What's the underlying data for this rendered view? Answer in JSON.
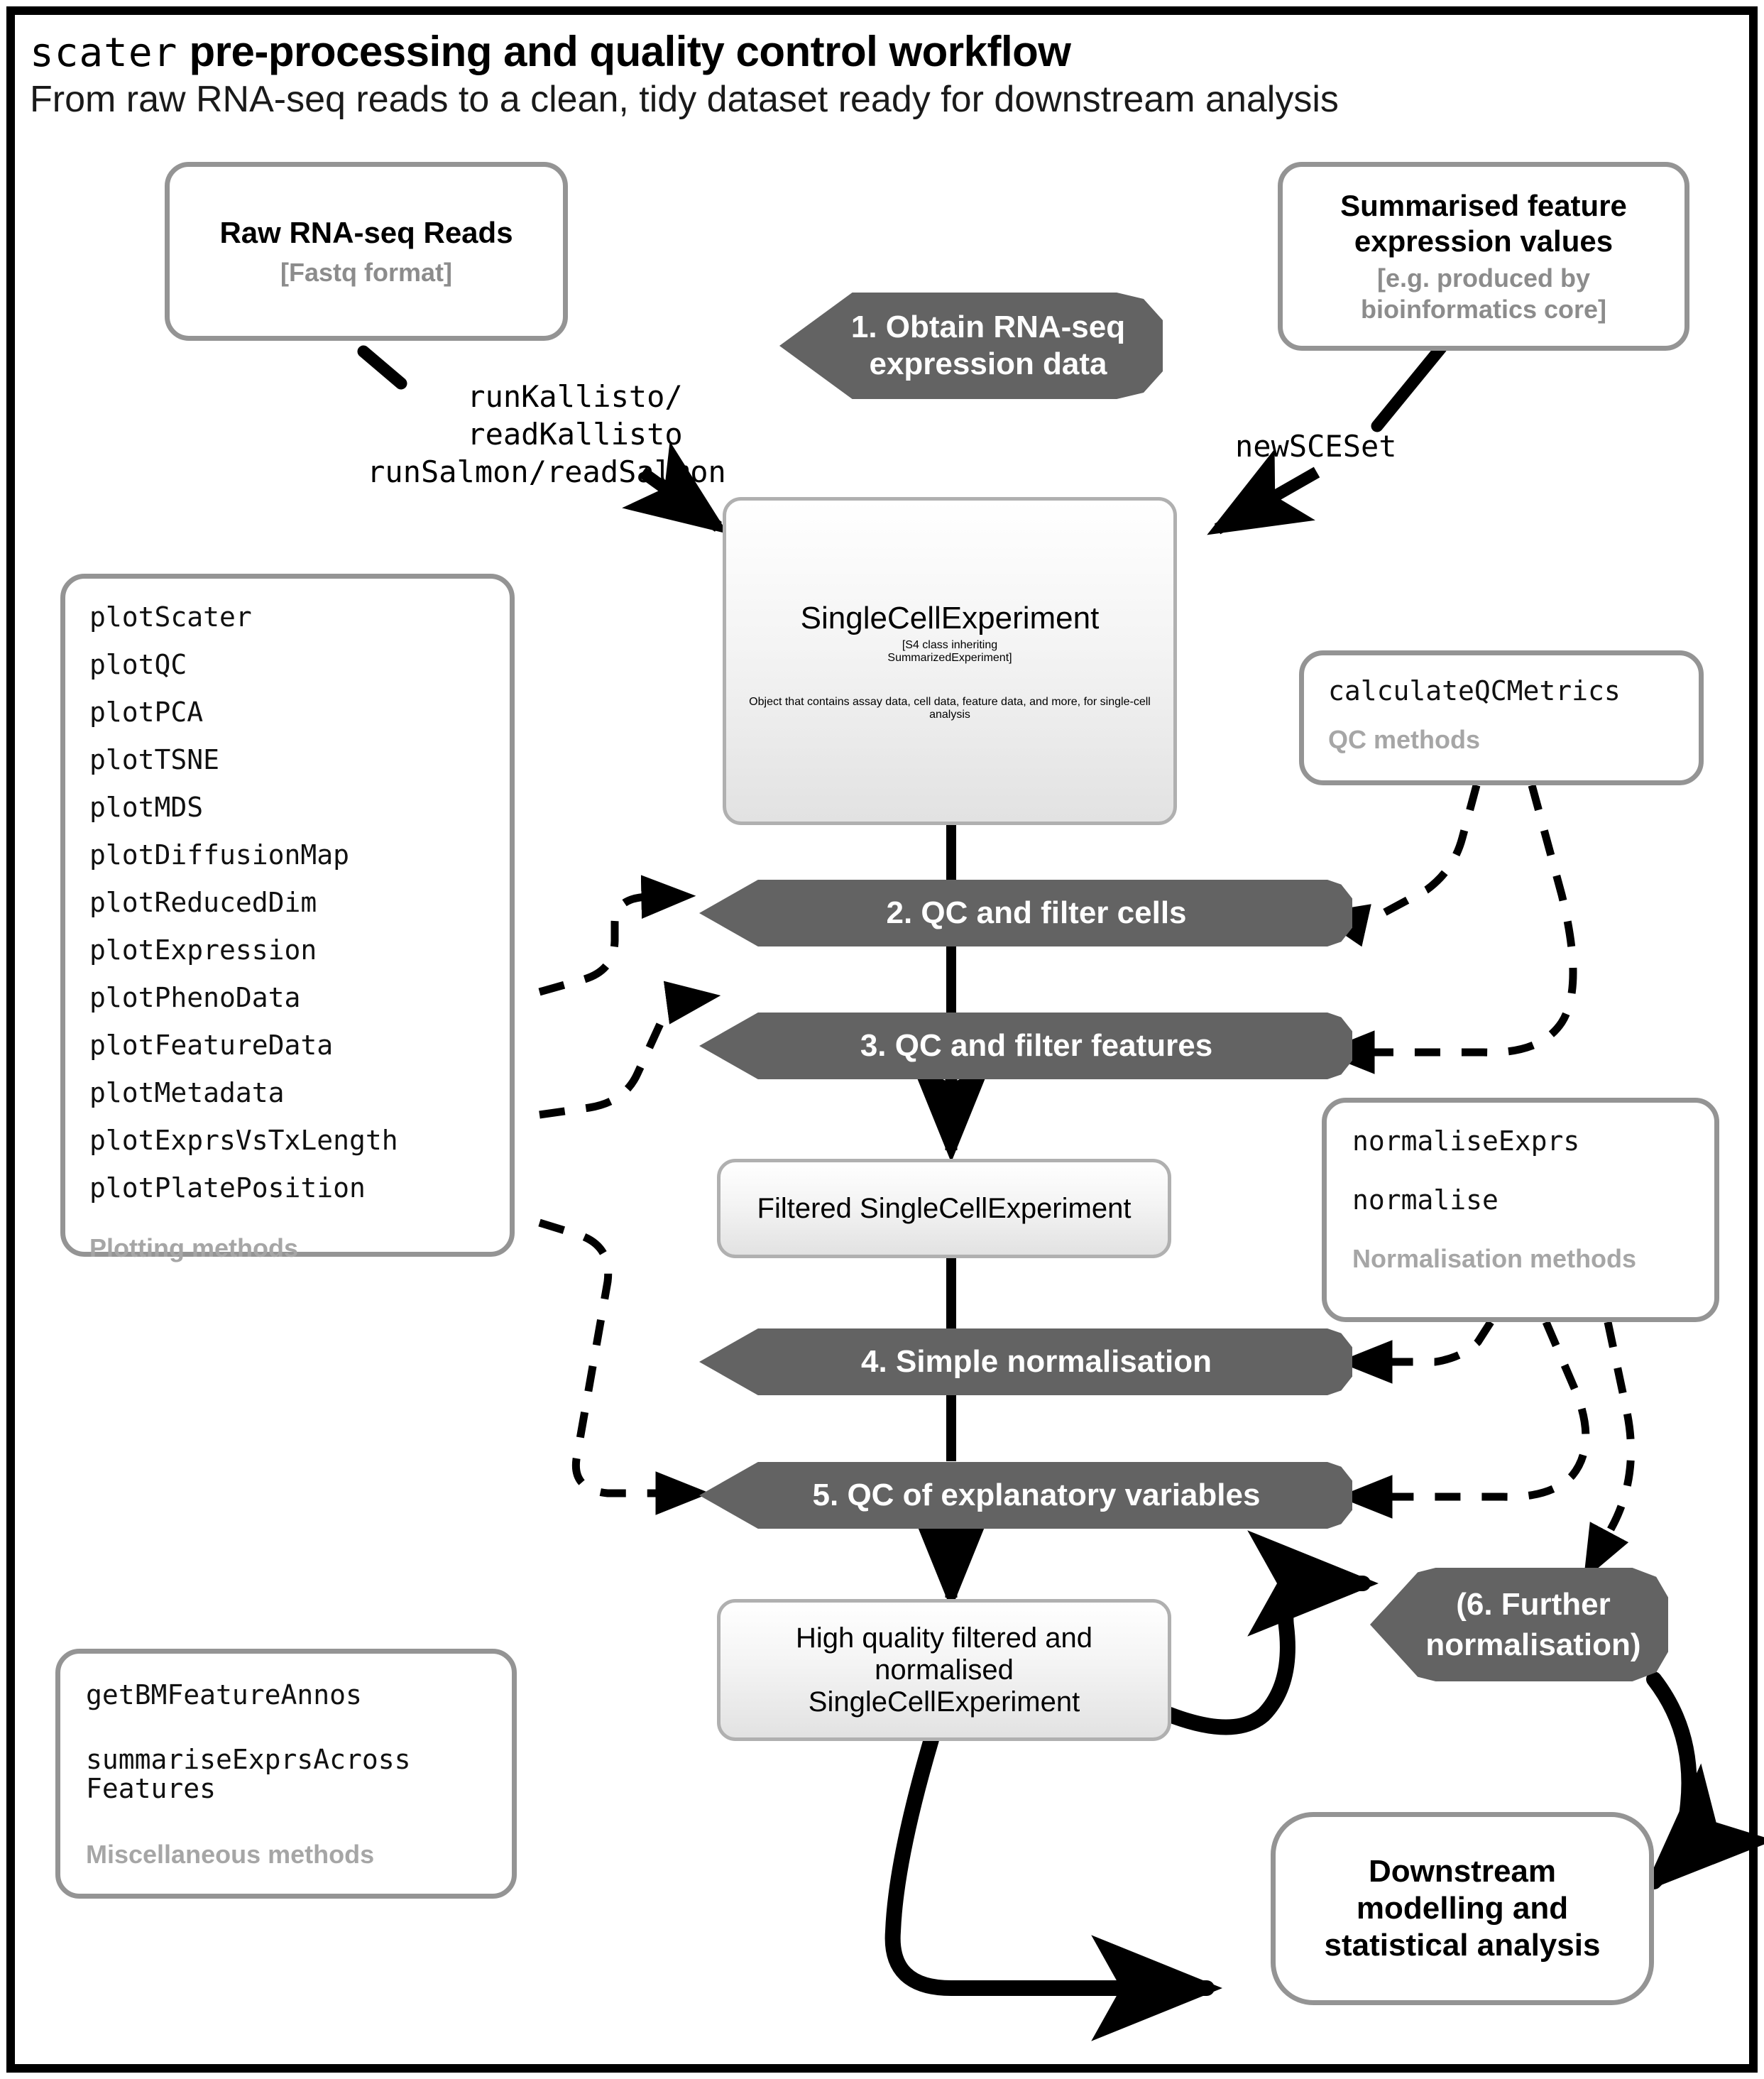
{
  "title": {
    "mono_part": "scater",
    "rest_part": " pre-processing and quality control workflow",
    "subtitle": "From raw RNA-seq reads to a clean, tidy dataset ready for downstream analysis"
  },
  "nodes": {
    "raw_reads": {
      "heading": "Raw RNA-seq Reads",
      "sub": "[Fastq format]"
    },
    "summarised": {
      "heading_line1": "Summarised feature",
      "heading_line2": "expression values",
      "sub_line1": "[e.g. produced by",
      "sub_line2": "bioinformatics core]"
    },
    "sce": {
      "heading": "SingleCellExperiment",
      "sub_line1": "[S4 class inheriting",
      "sub_line2": "SummarizedExperiment]",
      "body": "Object that contains assay data, cell data, feature data, and more, for single-cell analysis"
    },
    "filtered_sce": {
      "heading": "Filtered SingleCellExperiment"
    },
    "hq_sce": {
      "line1": "High quality filtered and",
      "line2": "normalised",
      "line3": "SingleCellExperiment"
    },
    "downstream": {
      "line1": "Downstream",
      "line2": "modelling and",
      "line3": "statistical analysis"
    }
  },
  "steps": [
    {
      "id": "step1",
      "line1": "1. Obtain RNA-seq",
      "line2": "expression data"
    },
    {
      "id": "step2",
      "label": "2. QC and filter cells"
    },
    {
      "id": "step3",
      "label": "3. QC and filter features"
    },
    {
      "id": "step4",
      "label": "4. Simple normalisation"
    },
    {
      "id": "step5",
      "label": "5. QC of explanatory variables"
    },
    {
      "id": "step6",
      "line1": "(6. Further",
      "line2": "normalisation)"
    }
  ],
  "edge_labels": {
    "kallisto_salmon_l1": "runKallisto/",
    "kallisto_salmon_l2": "readKallisto",
    "kallisto_salmon_l3": "runSalmon/readSalmon",
    "new_sceset": "newSCESet"
  },
  "method_boxes": {
    "plotting": {
      "items": [
        "plotScater",
        "plotQC",
        "plotPCA",
        "plotTSNE",
        "plotMDS",
        "plotDiffusionMap",
        "plotReducedDim",
        "plotExpression",
        "plotPhenoData",
        "plotFeatureData",
        "plotMetadata",
        "plotExprsVsTxLength",
        "plotPlatePosition"
      ],
      "caption": "Plotting methods"
    },
    "qc": {
      "items": [
        "calculateQCMetrics"
      ],
      "caption": "QC methods"
    },
    "normalisation": {
      "items": [
        "normaliseExprs",
        "normalise"
      ],
      "caption": "Normalisation methods"
    },
    "misc": {
      "items": [
        "getBMFeatureAnnos",
        "summariseExprsAcross",
        "Features"
      ],
      "caption": "Miscellaneous methods"
    }
  },
  "colors": {
    "step_fill": "#636363",
    "node_border": "#949494",
    "muted_text": "#8c8c8c",
    "frame": "#000000"
  }
}
